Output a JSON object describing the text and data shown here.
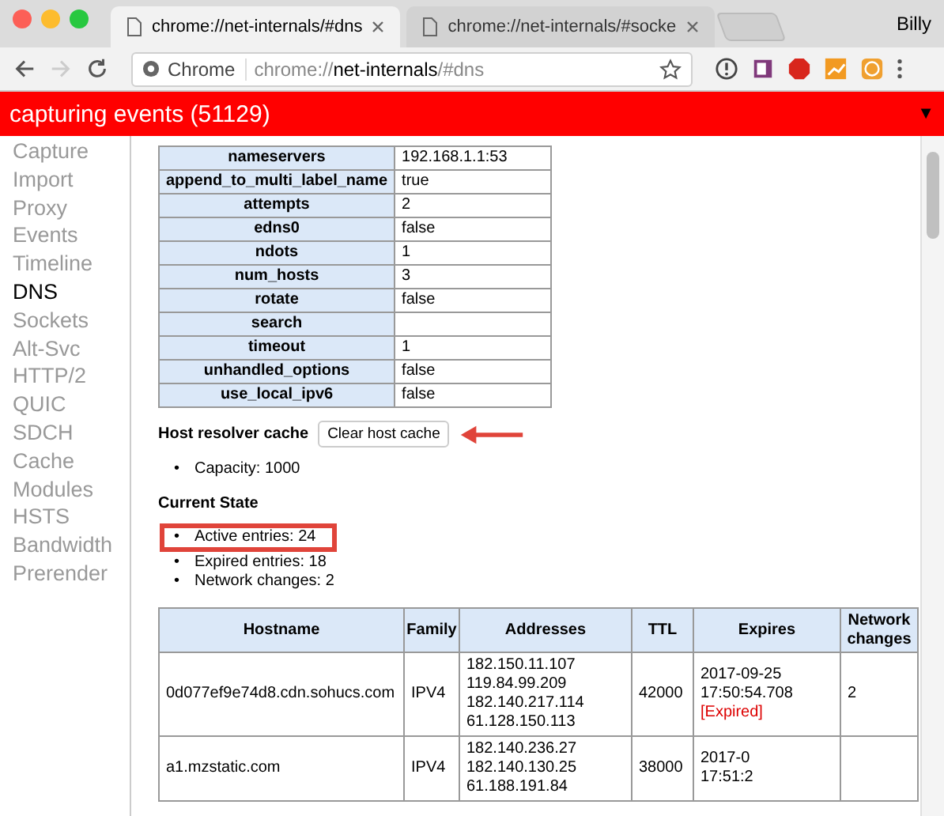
{
  "tabs": [
    {
      "title": "chrome://net-internals/#dns",
      "selected": true
    },
    {
      "title": "chrome://net-internals/#socke",
      "selected": false
    }
  ],
  "user": "Billy",
  "address": {
    "site_label": "Chrome",
    "prefix": "chrome://",
    "host": "net-internals",
    "suffix": "/#dns"
  },
  "banner": {
    "text": "capturing events (51129)",
    "caret": "▼"
  },
  "sidebar": {
    "items": [
      {
        "label": "Capture",
        "selected": false
      },
      {
        "label": "Import",
        "selected": false
      },
      {
        "label": "Proxy",
        "selected": false
      },
      {
        "label": "Events",
        "selected": false
      },
      {
        "label": "Timeline",
        "selected": false
      },
      {
        "label": "DNS",
        "selected": true
      },
      {
        "label": "Sockets",
        "selected": false
      },
      {
        "label": "Alt-Svc",
        "selected": false
      },
      {
        "label": "HTTP/2",
        "selected": false
      },
      {
        "label": "QUIC",
        "selected": false
      },
      {
        "label": "SDCH",
        "selected": false
      },
      {
        "label": "Cache",
        "selected": false
      },
      {
        "label": "Modules",
        "selected": false
      },
      {
        "label": "HSTS",
        "selected": false
      },
      {
        "label": "Bandwidth",
        "selected": false
      },
      {
        "label": "Prerender",
        "selected": false
      }
    ]
  },
  "config_table": [
    {
      "key": "nameservers",
      "value": "192.168.1.1:53"
    },
    {
      "key": "append_to_multi_label_name",
      "value": "true"
    },
    {
      "key": "attempts",
      "value": "2"
    },
    {
      "key": "edns0",
      "value": "false"
    },
    {
      "key": "ndots",
      "value": "1"
    },
    {
      "key": "num_hosts",
      "value": "3"
    },
    {
      "key": "rotate",
      "value": "false"
    },
    {
      "key": "search"
    },
    {
      "key": "timeout",
      "value": "1"
    },
    {
      "key": "unhandled_options",
      "value": "false"
    },
    {
      "key": "use_local_ipv6",
      "value": "false"
    }
  ],
  "host_cache": {
    "heading": "Host resolver cache",
    "button": "Clear host cache",
    "arrow": true,
    "items": [
      {
        "marker": "•",
        "text": "Capacity: 1000"
      }
    ]
  },
  "current_state": {
    "heading": "Current State",
    "items": [
      {
        "marker": "•",
        "text": "Active entries: 24",
        "highlighted": true
      },
      {
        "marker": "•",
        "text": "Expired entries: 18",
        "highlighted": false
      },
      {
        "marker": "•",
        "text": "Network changes: 2",
        "highlighted": false
      }
    ]
  },
  "cache_table": {
    "columns": [
      "Hostname",
      "Family",
      "Addresses",
      "TTL",
      "Expires",
      "Network changes"
    ],
    "rows": [
      {
        "hostname": "0d077ef9e74d8.cdn.sohucs.com",
        "family": "IPV4",
        "addresses": [
          "182.150.11.107",
          "119.84.99.209",
          "182.140.217.114",
          "61.128.150.113"
        ],
        "ttl": "42000",
        "expires": [
          "2017-09-25",
          "17:50:54.708"
        ],
        "expired_label": "[Expired]",
        "network_changes": "2"
      },
      {
        "hostname": "a1.mzstatic.com",
        "family": "IPV4",
        "addresses": [
          "182.140.236.27",
          "182.140.130.25",
          "61.188.191.84"
        ],
        "ttl": "38000",
        "expires": [
          "2017-0",
          "17:51:2"
        ]
      }
    ]
  }
}
